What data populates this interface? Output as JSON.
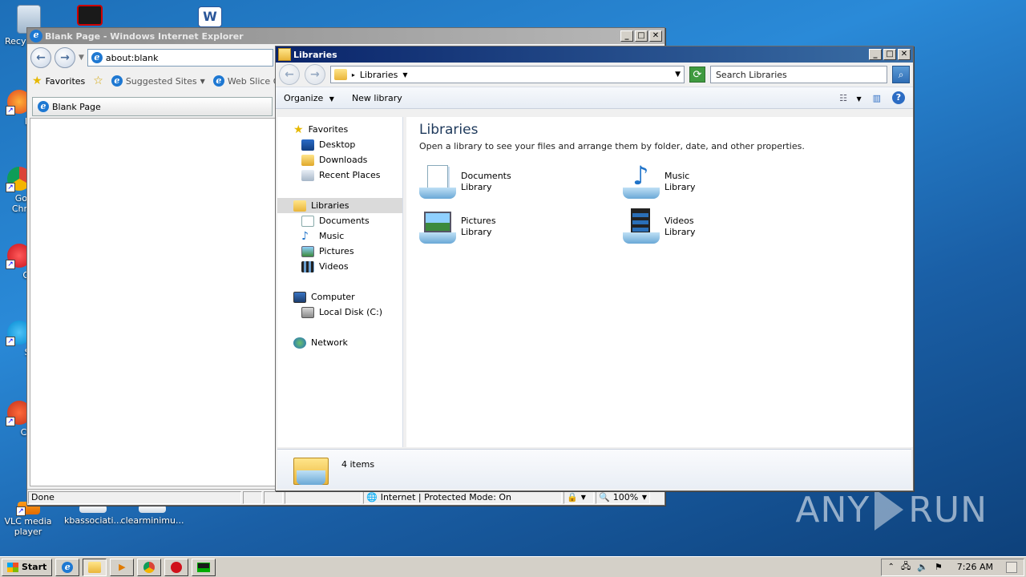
{
  "desktop": {
    "icons": [
      {
        "label": "Recy",
        "icon": "recycle-bin-icon"
      },
      {
        "label": "Fir",
        "icon": "firefox-icon"
      },
      {
        "label": "Go Chr",
        "icon": "chrome-icon"
      },
      {
        "label": "Op",
        "icon": "opera-icon"
      },
      {
        "label": "Sk",
        "icon": "skype-icon"
      },
      {
        "label": "CCl",
        "icon": "ccleaner-icon"
      },
      {
        "label": "VLC media player",
        "icon": "vlc-icon"
      },
      {
        "label": "kbassociati...",
        "icon": "document-icon"
      },
      {
        "label": "clearminimu...",
        "icon": "document-icon"
      }
    ],
    "watermark": "ANY RUN"
  },
  "ie": {
    "title": "Blank Page - Windows Internet Explorer",
    "address": "about:blank",
    "favorites_label": "Favorites",
    "suggested_sites": "Suggested Sites",
    "web_slice": "Web Slice G",
    "tab_label": "Blank Page",
    "status_text": "Done",
    "zone_text": "Internet | Protected Mode: On",
    "zoom": "100%"
  },
  "explorer": {
    "title": "Libraries",
    "breadcrumb": "Libraries",
    "search_placeholder": "Search Libraries",
    "organize": "Organize",
    "new_library": "New library",
    "nav": {
      "favorites": "Favorites",
      "desktop": "Desktop",
      "downloads": "Downloads",
      "recent_places": "Recent Places",
      "libraries": "Libraries",
      "documents": "Documents",
      "music": "Music",
      "pictures": "Pictures",
      "videos": "Videos",
      "computer": "Computer",
      "local_disk": "Local Disk (C:)",
      "network": "Network"
    },
    "main_title": "Libraries",
    "main_subtitle": "Open a library to see your files and arrange them by folder, date, and other properties.",
    "libraries": [
      {
        "name": "Documents",
        "type": "Library"
      },
      {
        "name": "Music",
        "type": "Library"
      },
      {
        "name": "Pictures",
        "type": "Library"
      },
      {
        "name": "Videos",
        "type": "Library"
      }
    ],
    "item_count": "4 items"
  },
  "taskbar": {
    "start_label": "Start",
    "clock": "7:26 AM"
  },
  "colors": {
    "desktop_blue": "#1d6fb8",
    "title_active": "#0a246a",
    "title_inactive": "#8a8a8a"
  }
}
